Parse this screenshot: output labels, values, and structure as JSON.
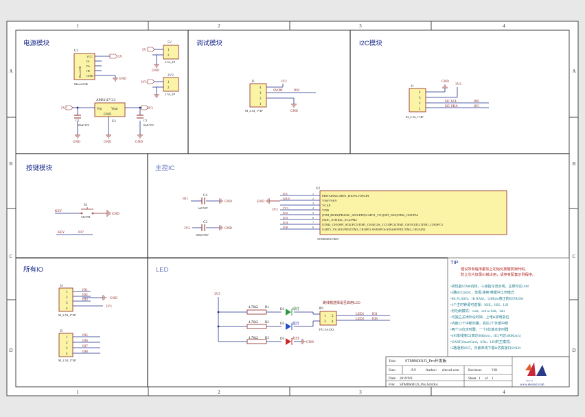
{
  "frame": {
    "col_labels": [
      "1",
      "2",
      "3",
      "4"
    ],
    "row_labels": [
      "A",
      "B",
      "C",
      "D"
    ]
  },
  "sections": {
    "power": "电源模块",
    "debug": "调试模块",
    "i2c": "I2C模块",
    "key": "按键模块",
    "mcu": "主控IC",
    "io": "所有IO",
    "led": "LED"
  },
  "power": {
    "u3_ref": "U3",
    "u3_name": "MicroUSB",
    "u3_rot": "MicroUSB",
    "u3_pins": [
      "VCC",
      "D-",
      "D+",
      "ID",
      "GND"
    ],
    "u3_net": "5V",
    "gnd": "GND",
    "j5_label": "5V",
    "j5_net": "5V",
    "j5_name": "2.54_2P",
    "j6_label": "3V3",
    "j6_net": "3V3",
    "j6_name": "2.54_2P",
    "reg_name": "AMS1117-3.3",
    "reg_ref": "U1",
    "reg_vin": "Vin",
    "reg_vout": "Vout",
    "reg_gnd": "GND",
    "vin_net": "5V",
    "vout_net": "3V3",
    "c1_ref": "C1",
    "c1_val": "100uF/10V",
    "c2_ref": "C2",
    "c2_val": "10uF/10V"
  },
  "debug": {
    "ref": "J3",
    "net_3v3": "3V3",
    "swim": "SWIM",
    "io": "IO8",
    "gnd": "GND",
    "name": "M_2.54_1*4P"
  },
  "i2c": {
    "ref": "J1",
    "gnd": "GND",
    "net_3v3": "3V3",
    "scl": "I2C SCL",
    "sda": "I2C SDA",
    "io_scl": "IO6",
    "io_sda": "IO5",
    "name": "M_2.54_1*4P"
  },
  "key": {
    "key_net": "KEY",
    "ref": "S1",
    "name": "SW-PB",
    "gnd": "GND",
    "key_net2": "KEY",
    "io": "IO7"
  },
  "mcu": {
    "ref": "U2",
    "name": "STM8S001J3M3",
    "c4_ref": "C4",
    "c4_val": "1uF/50V",
    "c3_ref": "C3",
    "c3_val": "100nF/50V",
    "io1": "IO1",
    "net_3v3": "3V3",
    "gnd": "GND",
    "left_nets": [
      "IO1",
      "GND",
      "",
      "3V3",
      "IO2",
      "IO3",
      "IO4",
      "IO8"
    ],
    "pin_nums": [
      "1",
      "2",
      "3",
      "4",
      "5",
      "6",
      "7",
      "8"
    ],
    "pins": [
      "PD6/AIN6/UART1_RX/PA1/OSCIN",
      "VSS/VSSA",
      "VCAP",
      "VDD",
      "[TIM_BKIN]PB4/I2C_SDA/PB5[UART1_TX]/[SPI_NSS]TIM2_CH3/PA3",
      "[ADC_ETR]I2C_SCL/PB4",
      "[TIM2_CH1]SPI_SCK/PC5/TIM1_CH4[CLK_CCO]PC4[TIM1_CH1N][TLI]TIM1_CH3/PC3",
      "UART1_TX/AIN3/PD5/[TIM1_CH1]PD1 SWIM/PC6/AIN4/SPI/PD1/TIM2_CH2/AIN4"
    ]
  },
  "io": {
    "j4_ref": "J4",
    "j4_nets": [
      "IO1",
      "IO2",
      "IO3",
      "GND",
      "3V3"
    ],
    "j4_name": "M_2.54_1*4P",
    "j5_ref": "J5",
    "j5_nets": [
      "IO5",
      "IO6",
      "IO7",
      "IO8"
    ],
    "j5_name": "M_2.54_1*4P"
  },
  "led": {
    "net_3v3": "3V3",
    "resistors": [
      {
        "val": "4.7KΩ",
        "ref": "R1"
      },
      {
        "val": "4.7KΩ",
        "ref": "R2"
      },
      {
        "val": "4.7KΩ",
        "ref": "R3"
      }
    ],
    "diodes": [
      {
        "ref": "D1",
        "color": "绿灯"
      },
      {
        "ref": "D2",
        "color": "蓝灯"
      },
      {
        "ref": "D3",
        "color": "红灯"
      }
    ],
    "note": "跳线帽选择是否启用LED",
    "jp_ref": "JP1",
    "jp_name": "TP2.54-2X2",
    "led_nets": [
      "LED1",
      "LED2"
    ],
    "io_nets": [
      "IO1",
      "IO8"
    ],
    "gnd": "GND"
  },
  "tip": {
    "title": "TIP",
    "intro": [
      "建议所有程序都加上初始化按键防锁代码,",
      "防止芯片烧录IO被占用，请参考配套示例程序。"
    ],
    "items": [
      "•高性能STM8内核，三级指令流水线，主频可达16M",
      "•3路IO口ADC，单极/连续/带缓冲工作模式",
      "•8K FLASH，1K RAM，128Byte真正的EEPROM",
      "•3个主时钟源可选择：HSE，HSI，LSI",
      "•低功耗模式：wait，active-halt，halt",
      "•可独立关闭外设时钟，上电&掉电复位",
      "•内嵌12个中断向量，高达1个外部中断",
      "•两个16位定时器，一个8位基本定时器",
      "•SPI单线接口(高达8Mbit/s)，IIC(可达400Kbit/s)",
      "•UART(SmartCard，IrDa，LIN的主模式)",
      "•5路通用IO口，内嵌单线下载&仿真接口SWIM"
    ]
  },
  "title_block": {
    "title_label": "Title:",
    "title_value": "STM8S001J3_Pro开发板",
    "size_label": "Size:",
    "size_value": "A4",
    "author_label": "Author:",
    "author_value": "elecosl.com",
    "rev_label": "Revision:",
    "rev_value": "V01",
    "date_label": "Date:",
    "date_value": "2019/9/8",
    "sheet_label": "Sheet",
    "sheet_value": "1",
    "of_label": "of",
    "of_value": "1",
    "file_label": "File:",
    "file_value": "STM8S001J3_Pro.SchDoc",
    "website": "www.elecosl.com",
    "logo_text": "elecosl"
  }
}
